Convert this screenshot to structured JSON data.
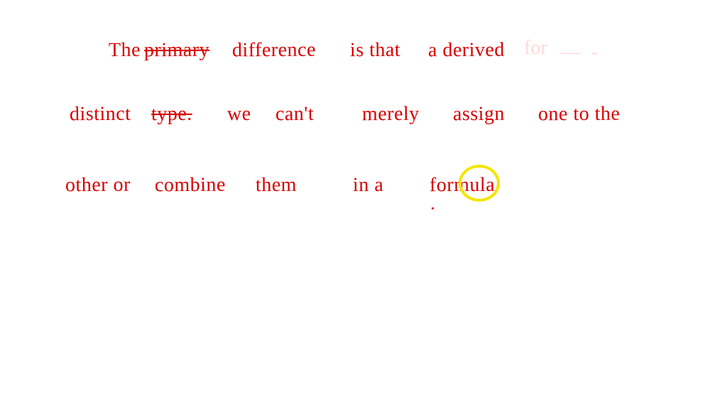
{
  "colors": {
    "ink": "#d80000",
    "highlight": "#f6e500"
  },
  "line1": {
    "w1": "The",
    "w2": "primary",
    "w3": "difference",
    "w4": "is that",
    "w5": "a derived",
    "w6": "for"
  },
  "line2": {
    "w1": "distinct",
    "w2": "type.",
    "w3": "we",
    "w4": "can't",
    "w5": "merely",
    "w6": "assign",
    "w7": "one to the"
  },
  "line3": {
    "w1": "other or",
    "w2": "combine",
    "w3": "them",
    "w4": "in a",
    "w5": "formula"
  },
  "annotation": {
    "shape": "circle",
    "target_word": "formula"
  }
}
